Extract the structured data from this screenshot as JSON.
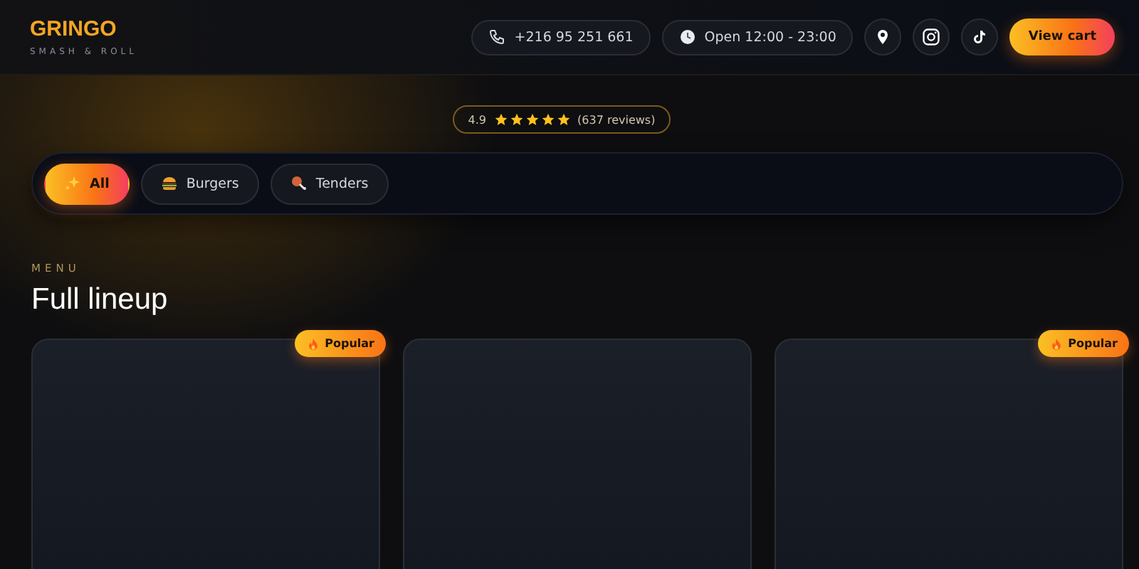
{
  "brand": {
    "name": "GRINGO",
    "tagline": "SMASH & ROLL"
  },
  "header": {
    "phone": "+216 95 251 661",
    "hours": "Open 12:00 - 23:00",
    "cart_button": "View cart"
  },
  "rating": {
    "score": "4.9",
    "stars": 5,
    "reviews": "(637 reviews)"
  },
  "filters": [
    {
      "label": "All",
      "kind": "sparkle",
      "selected": true
    },
    {
      "label": "Burgers",
      "kind": "burger",
      "selected": false
    },
    {
      "label": "Tenders",
      "kind": "drumstick",
      "selected": false
    }
  ],
  "section": {
    "eyebrow": "MENU",
    "title": "Full lineup"
  },
  "cards": [
    {
      "popular": true,
      "badge": "Popular"
    },
    {
      "popular": false
    },
    {
      "popular": true,
      "badge": "Popular"
    }
  ]
}
